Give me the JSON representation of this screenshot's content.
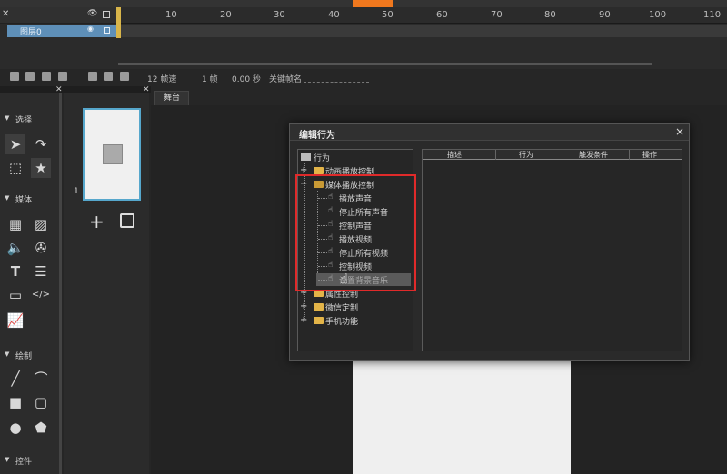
{
  "timeline": {
    "layer_name": "图层0",
    "ruler_ticks": [
      "10",
      "20",
      "30",
      "40",
      "50",
      "60",
      "70",
      "80",
      "90",
      "100",
      "110"
    ],
    "status": {
      "fps": "12 帧速",
      "frame": "1 帧",
      "time": "0.00 秒",
      "keyframe_label": "关键帧名"
    }
  },
  "stage": {
    "tab_label": "舞台"
  },
  "tools": {
    "sections": [
      "选择",
      "媒体",
      "绘制",
      "控件"
    ]
  },
  "pages": {
    "page_number": "1"
  },
  "dialog": {
    "title": "编辑行为",
    "close_symbol": "×",
    "tree": {
      "root": "行为",
      "items": [
        {
          "label": "动画播放控制",
          "type": "folder",
          "expanded": false
        },
        {
          "label": "媒体播放控制",
          "type": "folder",
          "expanded": true
        },
        {
          "label": "播放声音",
          "type": "action"
        },
        {
          "label": "停止所有声音",
          "type": "action"
        },
        {
          "label": "控制声音",
          "type": "action"
        },
        {
          "label": "播放视频",
          "type": "action"
        },
        {
          "label": "停止所有视频",
          "type": "action"
        },
        {
          "label": "控制视频",
          "type": "action"
        },
        {
          "label": "设置背景音乐",
          "type": "action",
          "selected": true
        },
        {
          "label": "属性控制",
          "type": "folder",
          "expanded": false
        },
        {
          "label": "微信定制",
          "type": "folder",
          "expanded": false
        },
        {
          "label": "手机功能",
          "type": "folder",
          "expanded": false
        }
      ]
    },
    "table": {
      "columns": [
        "描述",
        "行为",
        "触发条件",
        "操作"
      ]
    }
  },
  "colors": {
    "accent_orange": "#f0781e",
    "layer_blue": "#5e8fb8",
    "highlight_red": "#e02a2a",
    "page_border": "#56a7cc"
  }
}
